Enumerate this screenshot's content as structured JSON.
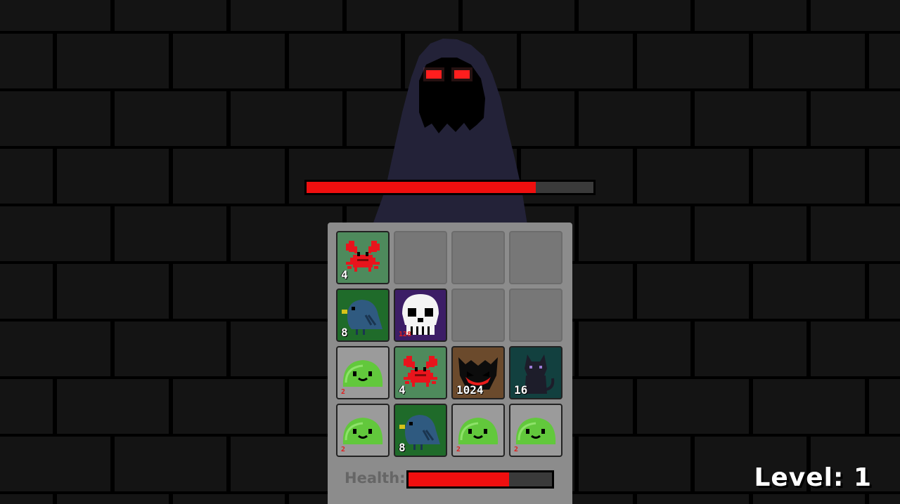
{
  "boss": {
    "name_icon": "hooded-shadow-icon",
    "health_fraction": 0.8,
    "colors": {
      "cloak": "#232238",
      "face": "#000000",
      "eyes": "#ff1010"
    }
  },
  "board": {
    "rows": [
      [
        {
          "creature": "crab",
          "icon": "crab-icon",
          "value": "4",
          "bg": "#4e8a5c"
        },
        null,
        null,
        null
      ],
      [
        {
          "creature": "bird",
          "icon": "bird-icon",
          "value": "8",
          "bg": "#1f6b2a"
        },
        {
          "creature": "skull",
          "icon": "skull-icon",
          "value": "128",
          "bg": "#3c1d66",
          "value_color": "red"
        },
        null,
        null
      ],
      [
        {
          "creature": "slime",
          "icon": "slime-icon",
          "value": "2",
          "bg": "#9b9b9b",
          "value_color": "red"
        },
        {
          "creature": "crab",
          "icon": "crab-icon",
          "value": "4",
          "bg": "#4e8a5c"
        },
        {
          "creature": "demon",
          "icon": "demon-icon",
          "value": "1024",
          "bg": "#6b4a2c"
        },
        {
          "creature": "cat",
          "icon": "cat-icon",
          "value": "16",
          "bg": "#12403f"
        }
      ],
      [
        {
          "creature": "slime",
          "icon": "slime-icon",
          "value": "2",
          "bg": "#9b9b9b",
          "value_color": "red"
        },
        {
          "creature": "bird",
          "icon": "bird-icon",
          "value": "8",
          "bg": "#1f6b2a"
        },
        {
          "creature": "slime",
          "icon": "slime-icon",
          "value": "2",
          "bg": "#9b9b9b",
          "value_color": "red"
        },
        {
          "creature": "slime",
          "icon": "slime-icon",
          "value": "2",
          "bg": "#9b9b9b",
          "value_color": "red"
        }
      ]
    ]
  },
  "player": {
    "health_label": "Health:",
    "health_fraction": 0.7
  },
  "level_text": "Level: 1"
}
